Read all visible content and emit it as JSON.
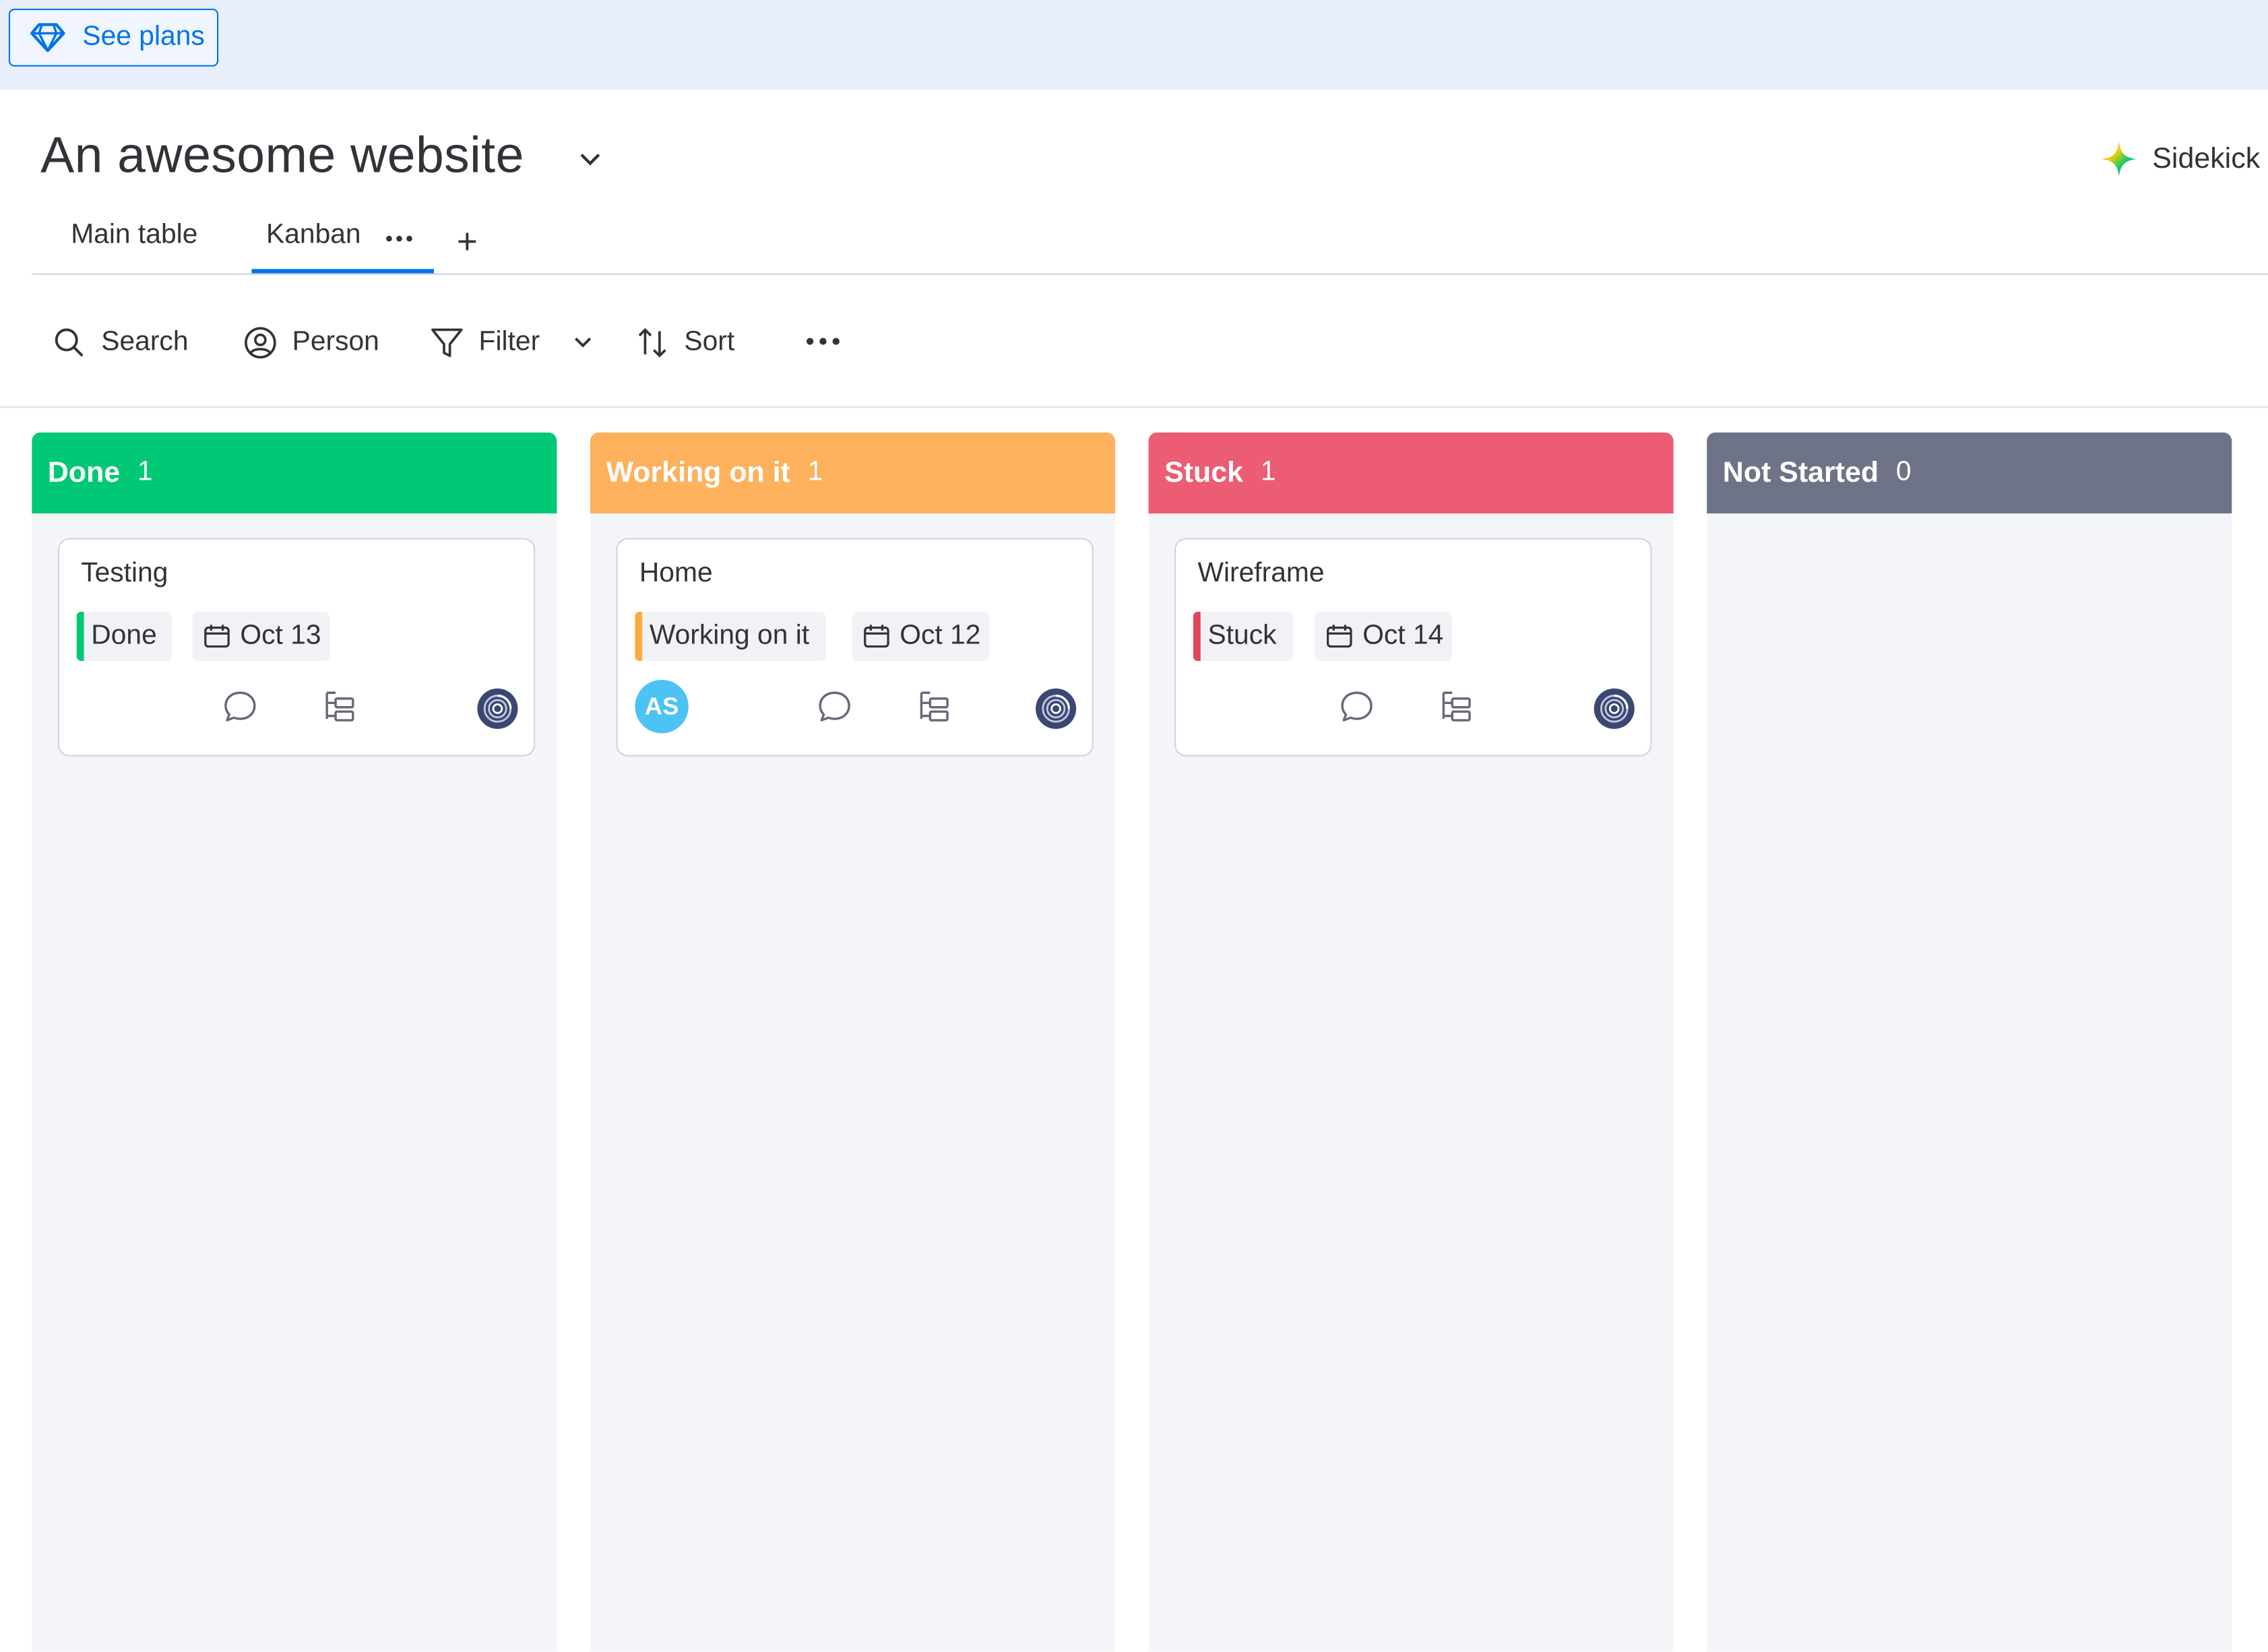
{
  "banner": {
    "see_plans_label": "See plans"
  },
  "board": {
    "title": "An awesome website",
    "sidekick_label": "Sidekick"
  },
  "tabs": [
    {
      "label": "Main table",
      "active": false
    },
    {
      "label": "Kanban",
      "active": true
    }
  ],
  "toolbar": {
    "search_label": "Search",
    "person_label": "Person",
    "filter_label": "Filter",
    "sort_label": "Sort"
  },
  "columns": [
    {
      "name": "Done",
      "count": "1",
      "color": "#00c875",
      "cards": [
        {
          "title": "Testing",
          "status": "Done",
          "date": "Oct 13",
          "status_color": "#00c875",
          "assignee": ""
        }
      ]
    },
    {
      "name": "Working on it",
      "count": "1",
      "color": "#fdb15c",
      "cards": [
        {
          "title": "Home",
          "status": "Working on it",
          "date": "Oct 12",
          "status_color": "#fdab3d",
          "assignee": "AS"
        }
      ]
    },
    {
      "name": "Stuck",
      "count": "1",
      "color": "#ec5c72",
      "cards": [
        {
          "title": "Wireframe",
          "status": "Stuck",
          "date": "Oct 14",
          "status_color": "#e2445c",
          "assignee": ""
        }
      ]
    },
    {
      "name": "Not Started",
      "count": "0",
      "color": "#6e7387",
      "cards": []
    }
  ],
  "colors": {
    "accent": "#0073ea",
    "text": "#323338",
    "column_bg": "#f4f5f9",
    "assignee_avatar": "#4cc2f5"
  },
  "icons": [
    "diamond-icon",
    "chevron-down-icon",
    "sidekick-sparkle-icon",
    "tab-more-icon",
    "plus-icon",
    "search-icon",
    "person-icon",
    "filter-icon",
    "sort-icon",
    "more-icon",
    "calendar-icon",
    "comment-icon",
    "subitems-icon",
    "owner-avatar-icon"
  ]
}
